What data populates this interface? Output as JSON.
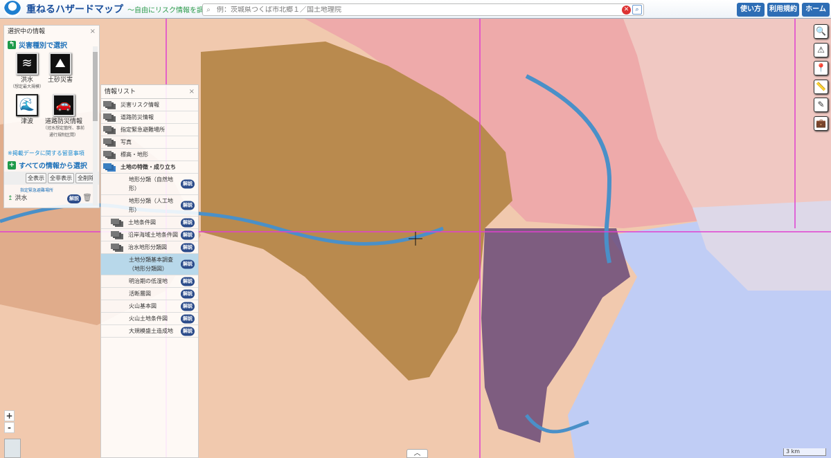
{
  "header": {
    "title": "重ねるハザードマップ",
    "subtitle": "～自由にリスク情報を調べる～",
    "search_placeholder": "例：茨城県つくば市北郷１／国土地理院",
    "buttons": [
      "使い方",
      "利用規約",
      "ホーム"
    ]
  },
  "selected_panel": {
    "title": "選択中の情報",
    "by_type": "災害種別で選択",
    "hazards": [
      {
        "label": "洪水",
        "sub": "（想定最大規模）",
        "icon": "flood-icon"
      },
      {
        "label": "土砂災害",
        "sub": "",
        "icon": "landslide-icon"
      },
      {
        "label": "津波",
        "sub": "",
        "icon": "tsunami-icon"
      },
      {
        "label": "道路防災情報",
        "sub": "（冠水想定箇所、事前通行規制区間）",
        "icon": "road-disaster-icon"
      }
    ],
    "notice": "※掲載データに関する留意事項",
    "all_info": "すべての情報から選択",
    "show_all": "全表示",
    "hide_all": "全非表示",
    "delete_all": "全削除",
    "layer_category": "指定緊急避難場所",
    "layer_name": "洪水",
    "explain": "解説"
  },
  "info_list": {
    "title": "情報リスト",
    "categories": [
      "災害リスク情報",
      "道路防災情報",
      "指定緊急避難場所",
      "写真",
      "標高・地形"
    ],
    "open_category": "土地の特徴・成り立ち",
    "items": [
      {
        "label": "地形分類（自然地形）",
        "level": 2
      },
      {
        "label": "地形分類（人工地形）",
        "level": 2
      },
      {
        "label": "土地条件図",
        "level": 1
      },
      {
        "label": "沿岸海域土地条件図",
        "level": 1
      },
      {
        "label": "治水地形分類図",
        "level": 1
      },
      {
        "label": "土地分類基本調査（地形分類図）",
        "level": 2,
        "selected": true
      },
      {
        "label": "明治期の低湿地",
        "level": 2
      },
      {
        "label": "活断層図",
        "level": 2
      },
      {
        "label": "火山基本図",
        "level": 2
      },
      {
        "label": "火山土地条件図",
        "level": 2
      },
      {
        "label": "大規模盛土造成地",
        "level": 2
      }
    ],
    "explain": "解説"
  },
  "map": {
    "scale": "3 km",
    "zoom_in": "+",
    "zoom_out": "-",
    "colors": {
      "base": "#f3cdb6",
      "brown": "#b98a4e",
      "sea": "#c0cdf5",
      "purple": "#6a4a78",
      "pink": "#ec9fa8",
      "boundary": "#e040d0",
      "river": "#4a90c8"
    }
  },
  "tools": [
    "search-area-icon",
    "hazard-search-icon",
    "location-pin-icon",
    "ruler-icon",
    "pencil-icon",
    "briefcase-icon"
  ]
}
